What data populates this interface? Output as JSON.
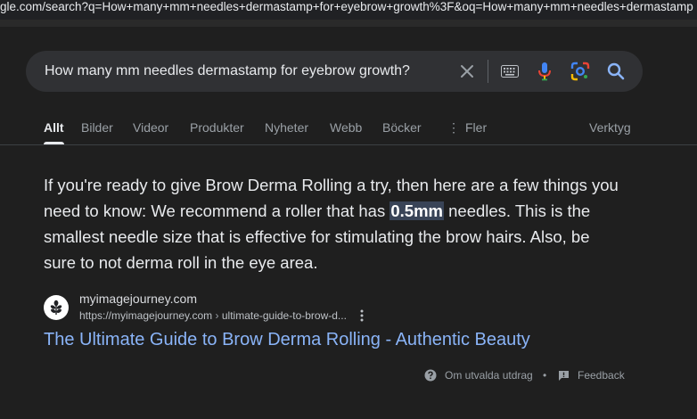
{
  "browser": {
    "url": "gle.com/search?q=How+many+mm+needles+dermastamp+for+eyebrow+growth%3F&oq=How+many+mm+needles+dermastamp"
  },
  "search": {
    "query": "How many mm needles dermastamp for eyebrow growth?"
  },
  "tabs": [
    {
      "label": "Allt",
      "active": true
    },
    {
      "label": "Bilder"
    },
    {
      "label": "Videor"
    },
    {
      "label": "Produkter"
    },
    {
      "label": "Nyheter"
    },
    {
      "label": "Webb"
    },
    {
      "label": "Böcker"
    },
    {
      "label": "Fler"
    }
  ],
  "tools_label": "Verktyg",
  "featured": {
    "text_before": "If you're ready to give Brow Derma Rolling a try, then here are a few things you need to know: We recommend a roller that has ",
    "highlight": "0.5mm",
    "text_after": " needles. This is the smallest needle size that is effective for stimulating the brow hairs. Also, be sure to not derma roll in the eye area.",
    "site_name": "myimagejourney.com",
    "cite_url": "https://myimagejourney.com",
    "cite_path": "ultimate-guide-to-brow-d...",
    "cite_sep": "›",
    "title": "The Ultimate Guide to Brow Derma Rolling - Authentic Beauty",
    "about_label": "Om utvalda utdrag",
    "dot": "•",
    "feedback_label": "Feedback"
  },
  "colors": {
    "background": "#1f1f1f",
    "searchbox": "#303134",
    "link": "#8ab4f8",
    "highlight": "#394457"
  },
  "icons": [
    "clear-icon",
    "keyboard-icon",
    "mic-icon",
    "lens-icon",
    "search-icon",
    "more-vert-icon",
    "help-icon",
    "feedback-icon",
    "leaf-icon"
  ]
}
